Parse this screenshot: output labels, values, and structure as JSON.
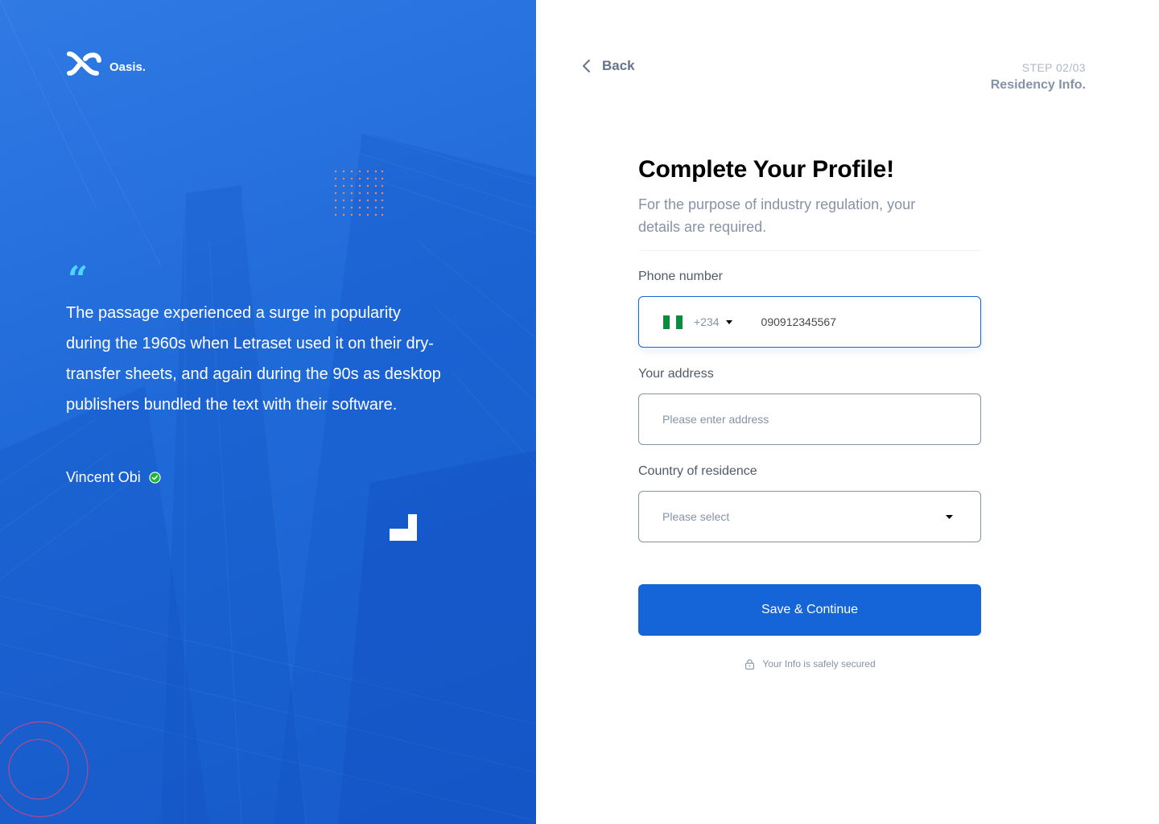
{
  "brand": {
    "name": "Oasis.",
    "logo_icon": "oasis-logo-icon"
  },
  "testimonial": {
    "quote_mark": "“",
    "text": "The passage experienced a surge in popularity during the 1960s when Letraset used it on their dry-transfer sheets, and again during the 90s as desktop publishers bundled the text with their software.",
    "author": "Vincent Obi",
    "verified_icon": "check-circle-icon"
  },
  "nav": {
    "back_label": "Back",
    "back_icon": "chevron-left-icon"
  },
  "step": {
    "count": "STEP 02/03",
    "title": "Residency Info."
  },
  "form": {
    "title": "Complete Your Profile!",
    "subtitle": "For the purpose of industry regulation, your details are required.",
    "phone": {
      "label": "Phone number",
      "country_flag": "nigeria-flag",
      "dial_code": "+234",
      "value": "090912345567"
    },
    "address": {
      "label": "Your address",
      "placeholder": "Please enter address",
      "value": ""
    },
    "country": {
      "label": "Country of residence",
      "selected": "Please select"
    },
    "submit_label": "Save & Continue",
    "secure_text": "Your Info is safely secured",
    "secure_icon": "lock-icon"
  },
  "colors": {
    "primary": "#1565D8",
    "left_panel": "#2672DE",
    "text_dark": "#000000",
    "text_muted": "#8692A6",
    "accent_quote": "#4FD3FF",
    "verified_green": "#1EB53A"
  }
}
